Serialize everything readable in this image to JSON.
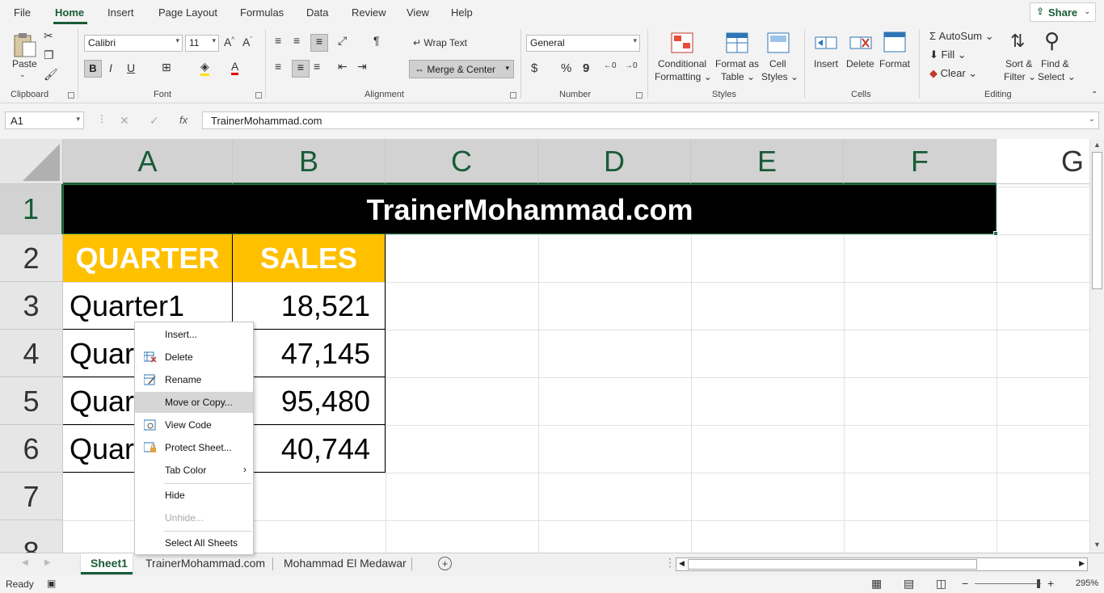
{
  "menubar": {
    "tabs": [
      "File",
      "Home",
      "Insert",
      "Page Layout",
      "Formulas",
      "Data",
      "Review",
      "View",
      "Help"
    ],
    "share": "Share"
  },
  "ribbon": {
    "clipboard": {
      "label": "Clipboard",
      "paste": "Paste"
    },
    "font": {
      "label": "Font",
      "name": "Calibri",
      "size": "11",
      "bold": "B",
      "italic": "I",
      "underline": "U"
    },
    "alignment": {
      "label": "Alignment",
      "wrap_text": "Wrap Text",
      "merge_center": "Merge & Center"
    },
    "number": {
      "label": "Number",
      "format": "General",
      "currency": "$",
      "percent": "%",
      "comma": "9"
    },
    "styles": {
      "label": "Styles",
      "conditional": "Conditional",
      "formatting": "Formatting",
      "format_as": "Format as",
      "table": "Table",
      "cell": "Cell",
      "styles_word": "Styles"
    },
    "cells": {
      "label": "Cells",
      "insert": "Insert",
      "delete": "Delete",
      "format": "Format"
    },
    "editing": {
      "label": "Editing",
      "autosum": "AutoSum",
      "fill": "Fill",
      "clear": "Clear",
      "sort": "Sort &",
      "filter": "Filter",
      "find": "Find &",
      "select": "Select"
    }
  },
  "formula_bar": {
    "name_box": "A1",
    "fx": "fx",
    "cancel": "✕",
    "enter": "✓",
    "value": "TrainerMohammad.com"
  },
  "columns": [
    "A",
    "B",
    "C",
    "D",
    "E",
    "F",
    "G"
  ],
  "rows": [
    "1",
    "2",
    "3",
    "4",
    "5",
    "6",
    "7",
    "8"
  ],
  "sheet": {
    "title": "TrainerMohammad.com",
    "header_quarter": "QUARTER",
    "header_sales": "SALES",
    "a3": "Quarter1",
    "a4": "Quar",
    "a5": "Quar",
    "a6": "Quar",
    "b3": "18,521",
    "b4": "47,145",
    "b5": "95,480",
    "b6": "40,744"
  },
  "context_menu": {
    "insert": "Insert...",
    "delete": "Delete",
    "rename": "Rename",
    "move_copy": "Move or Copy...",
    "view_code": "View Code",
    "protect": "Protect Sheet...",
    "tab_color": "Tab Color",
    "hide": "Hide",
    "unhide": "Unhide...",
    "select_all": "Select All Sheets"
  },
  "sheet_tabs": [
    "Sheet1",
    "TrainerMohammad.com",
    "Mohammad El Medawar"
  ],
  "status": {
    "ready": "Ready",
    "zoom": "295%"
  },
  "colors": {
    "accent": "#185c37",
    "title_bg": "#000000",
    "header_bg": "#ffc000"
  }
}
